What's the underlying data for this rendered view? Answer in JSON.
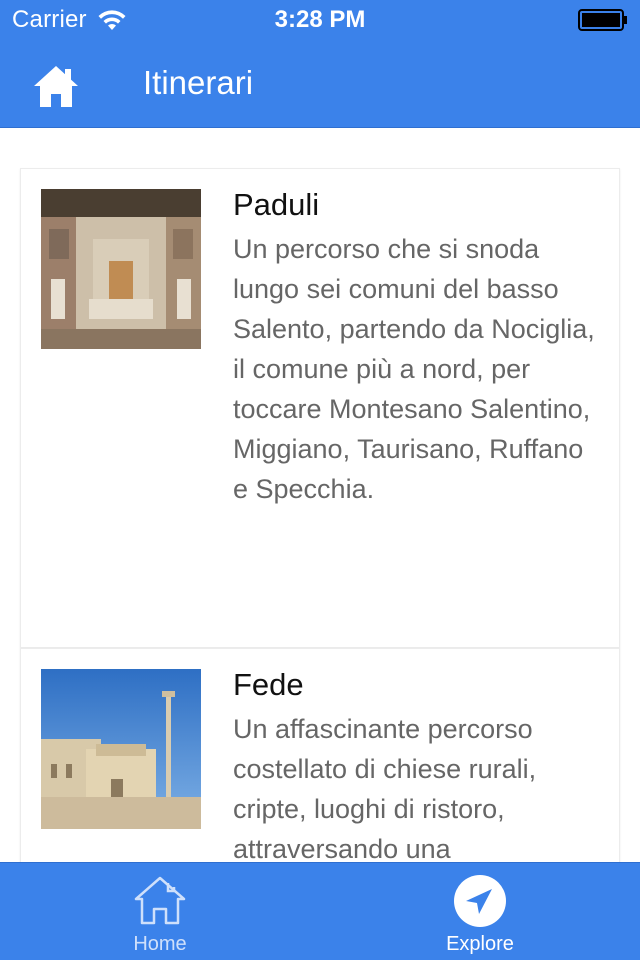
{
  "status_bar": {
    "carrier": "Carrier",
    "time": "3:28 PM"
  },
  "nav": {
    "title": "Itinerari",
    "home_icon": "home-icon"
  },
  "itineraries": [
    {
      "title": "Paduli",
      "description": "Un percorso che si snoda lungo sei comuni del basso Salento, partendo da Nociglia, il comune più a nord, per toccare Montesano Salentino, Miggiano, Taurisano, Ruffano e Specchia."
    },
    {
      "title": "Fede",
      "description": "Un affascinante percorso costellato di chiese rurali, cripte, luoghi di ristoro, attraversando una"
    }
  ],
  "tab_bar": {
    "tabs": [
      {
        "label": "Home",
        "icon": "home-outline-icon",
        "selected": false
      },
      {
        "label": "Explore",
        "icon": "navigation-arrow-icon",
        "selected": true
      }
    ]
  },
  "colors": {
    "accent": "#3b82ea",
    "text_primary": "#111111",
    "text_secondary": "#666666"
  }
}
